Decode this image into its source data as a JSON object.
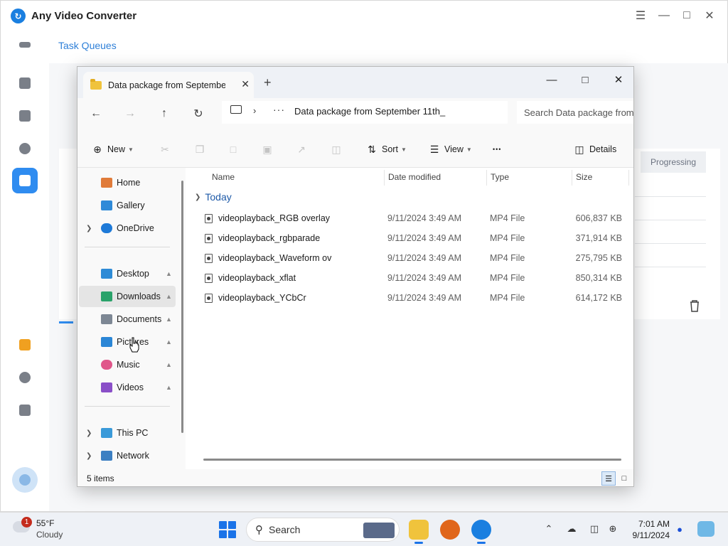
{
  "app": {
    "title": "Any Video Converter",
    "task_queues_link": "Task Queues",
    "progress_header": "Progressing",
    "accent_color": "#2f8cf0"
  },
  "explorer": {
    "tab_label": "Data package from September",
    "address_crumb": "Data package from September 11th_",
    "search_placeholder": "Search Data package from",
    "commands": {
      "new": "New",
      "sort": "Sort",
      "view": "View",
      "more": "•••",
      "details": "Details"
    },
    "nav": {
      "home": "Home",
      "gallery": "Gallery",
      "onedrive": "OneDrive",
      "desktop": "Desktop",
      "downloads": "Downloads",
      "documents": "Documents",
      "pictures": "Pictures",
      "music": "Music",
      "videos": "Videos",
      "this_pc": "This PC",
      "network": "Network"
    },
    "columns": {
      "name": "Name",
      "date": "Date modified",
      "type": "Type",
      "size": "Size"
    },
    "group": "Today",
    "files": [
      {
        "name": "videoplayback_RGB overlay",
        "date": "9/11/2024 3:49 AM",
        "type": "MP4 File",
        "size": "606,837 KB"
      },
      {
        "name": "videoplayback_rgbparade",
        "date": "9/11/2024 3:49 AM",
        "type": "MP4 File",
        "size": "371,914 KB"
      },
      {
        "name": "videoplayback_Waveform ov",
        "date": "9/11/2024 3:49 AM",
        "type": "MP4 File",
        "size": "275,795 KB"
      },
      {
        "name": "videoplayback_xflat",
        "date": "9/11/2024 3:49 AM",
        "type": "MP4 File",
        "size": "850,314 KB"
      },
      {
        "name": "videoplayback_YCbCr",
        "date": "9/11/2024 3:49 AM",
        "type": "MP4 File",
        "size": "614,172 KB"
      }
    ],
    "status_count": "5 items"
  },
  "taskbar": {
    "weather_badge": "1",
    "weather_temp": "55°F",
    "weather_cond": "Cloudy",
    "search_label": "Search",
    "time": "7:01 AM",
    "date": "9/11/2024"
  }
}
